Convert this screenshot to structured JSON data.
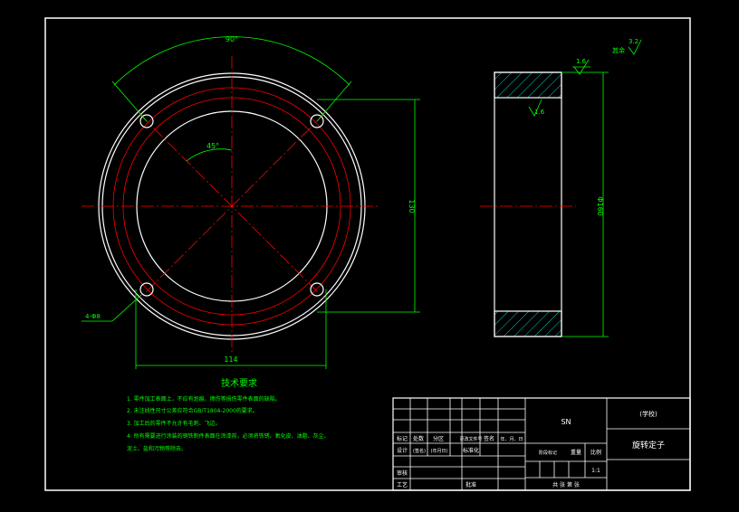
{
  "colors": {
    "background": "#000000",
    "frame": "#ffffff",
    "dimension": "#00ff00",
    "center_line": "#ff0000",
    "hatch": "#00ffff",
    "note_text": "#00ff00",
    "title_text": "#ffffff"
  },
  "front_view": {
    "angle_90": "90°",
    "angle_45": "45°",
    "dim_130": "130",
    "dim_114": "114",
    "hole_callout": "4-Φ8"
  },
  "side_view": {
    "roughness_top": "1.6",
    "roughness_inner": "1.6",
    "roughness_rest": "3.2",
    "rest_label": "其余",
    "dim_160": "Φ160"
  },
  "notes": {
    "title": "技术要求",
    "lines": [
      "1. 零件加工表面上，不应有划痕、擦伤等损伤零件表面的缺陷。",
      "2. 未注线性尺寸公差应符合GB/T1804-2000的要求。",
      "3. 加工后的零件不允许有毛刺、飞边。",
      "4. 所有需要进行涂装的钢铁制件表面在涂漆前，必须将铁锈、氧化皮、油脂、灰尘、",
      "泥土、盐和污物等除去。"
    ]
  },
  "title_block": {
    "material": "SN",
    "school": "(学校)",
    "part_name": "旋转定子",
    "label_biaoji": "标记",
    "label_chushu": "处数",
    "label_fenqu": "分区",
    "label_gengaiwenjian": "更改文件号",
    "label_qianming": "签名",
    "label_nianyueri": "年、月、日",
    "label_sheji": "设计",
    "label_qianming_paren": "(签名)",
    "label_nianyueri_paren": "(年月日)",
    "label_biaozhunhua": "标准化",
    "label_shenhe": "审核",
    "label_gongyi": "工艺",
    "label_pizhun": "批准",
    "label_zhongliang": "重量",
    "label_bili": "比例",
    "scale": "1:1",
    "sheet_info": "共  张  第  张",
    "label_jieduan": "阶段标记"
  }
}
